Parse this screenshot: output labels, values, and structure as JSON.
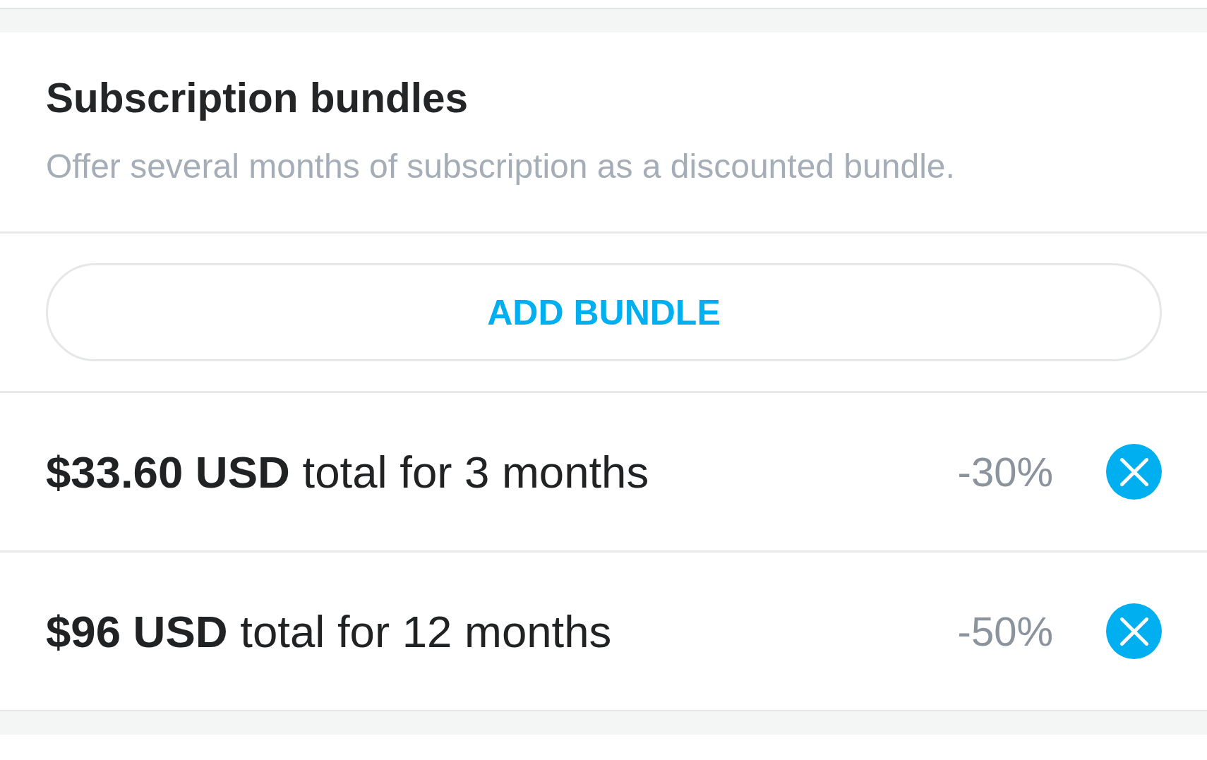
{
  "header": {
    "title": "Subscription bundles",
    "description": "Offer several months of subscription as a discounted bundle."
  },
  "add_button": {
    "label": "ADD BUNDLE"
  },
  "bundles": [
    {
      "summary": "**$33.60 USD** total for 3 months",
      "discount": "-30%"
    },
    {
      "summary": "**$96 USD** total for 12 months",
      "discount": "-50%"
    }
  ]
}
